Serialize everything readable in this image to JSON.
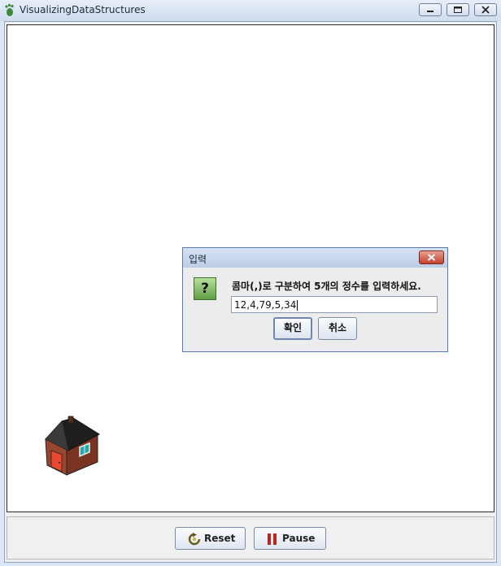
{
  "window": {
    "title": "VisualizingDataStructures",
    "controls": [
      "minimize",
      "maximize",
      "close"
    ]
  },
  "dialog": {
    "title": "입력",
    "icon": "question-icon",
    "message": "콤마(,)로 구분하여 5개의 정수를 입력하세요.",
    "input_value": "12,4,79,5,34",
    "ok_label": "확인",
    "cancel_label": "취소"
  },
  "toolbar": {
    "reset_label": "Reset",
    "pause_label": "Pause",
    "reset_icon": "refresh-icon",
    "pause_icon": "pause-icon"
  },
  "canvas": {
    "icon": "house-icon"
  },
  "colors": {
    "titlebar": "#cfdcee",
    "canvas_bg": "#ffffff",
    "dialog_border": "#5b7aa6",
    "close_button": "#c3412e",
    "question_icon": "#5e9f45",
    "pause_icon": "#c0271c",
    "house_roof": "#1f1f1f",
    "house_wall": "#8a3a26",
    "house_door": "#e94a2f"
  }
}
